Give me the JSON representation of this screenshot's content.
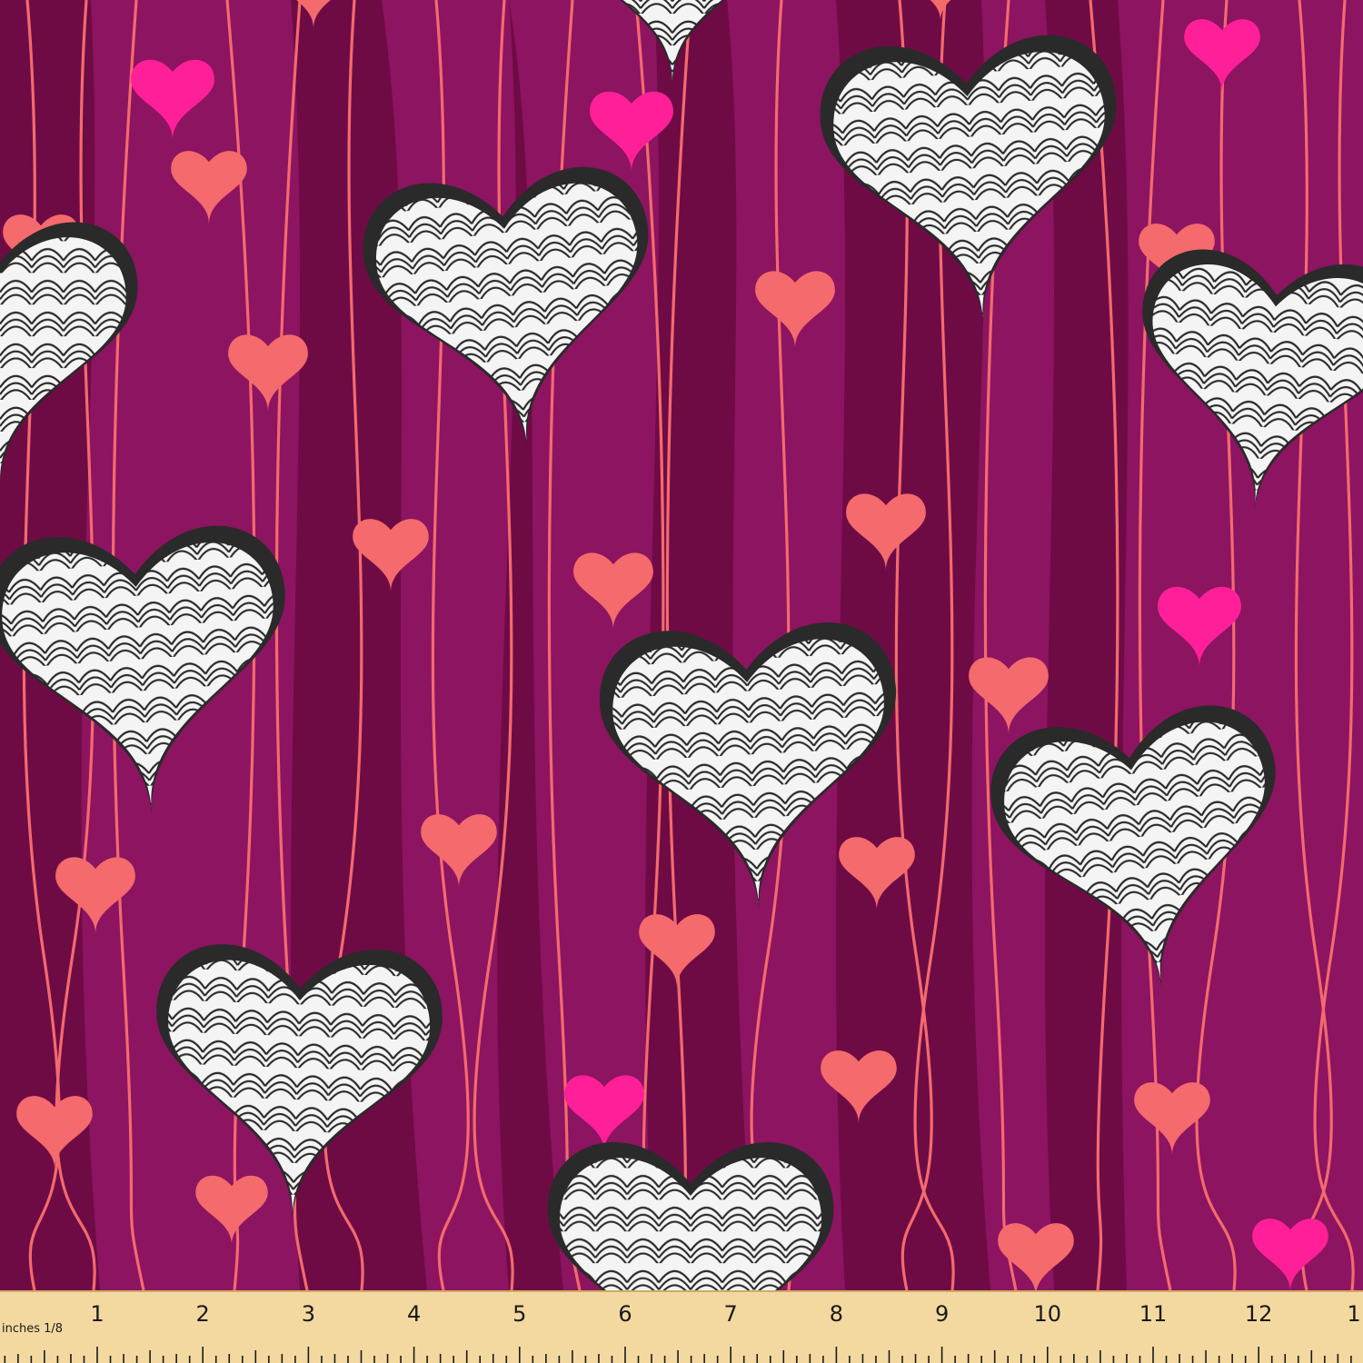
{
  "fabric": {
    "colors": {
      "dark_stripe": "#6e0b45",
      "light_stripe": "#8c1460",
      "string": "#f46a6d",
      "coral_heart": "#f46a6d",
      "magenta_heart": "#ff1f99",
      "swirl_outline": "#2a2a2a",
      "swirl_fill": "#f4f4f4"
    },
    "motifs": [
      "swirl-heart",
      "coral-heart",
      "magenta-heart",
      "hanging-string"
    ]
  },
  "ruler": {
    "caption": "inches 1/8",
    "labels": [
      "1",
      "2",
      "3",
      "4",
      "5",
      "6",
      "7",
      "8",
      "9",
      "10",
      "11",
      "12",
      "1"
    ],
    "background": "#f3d9a0"
  }
}
